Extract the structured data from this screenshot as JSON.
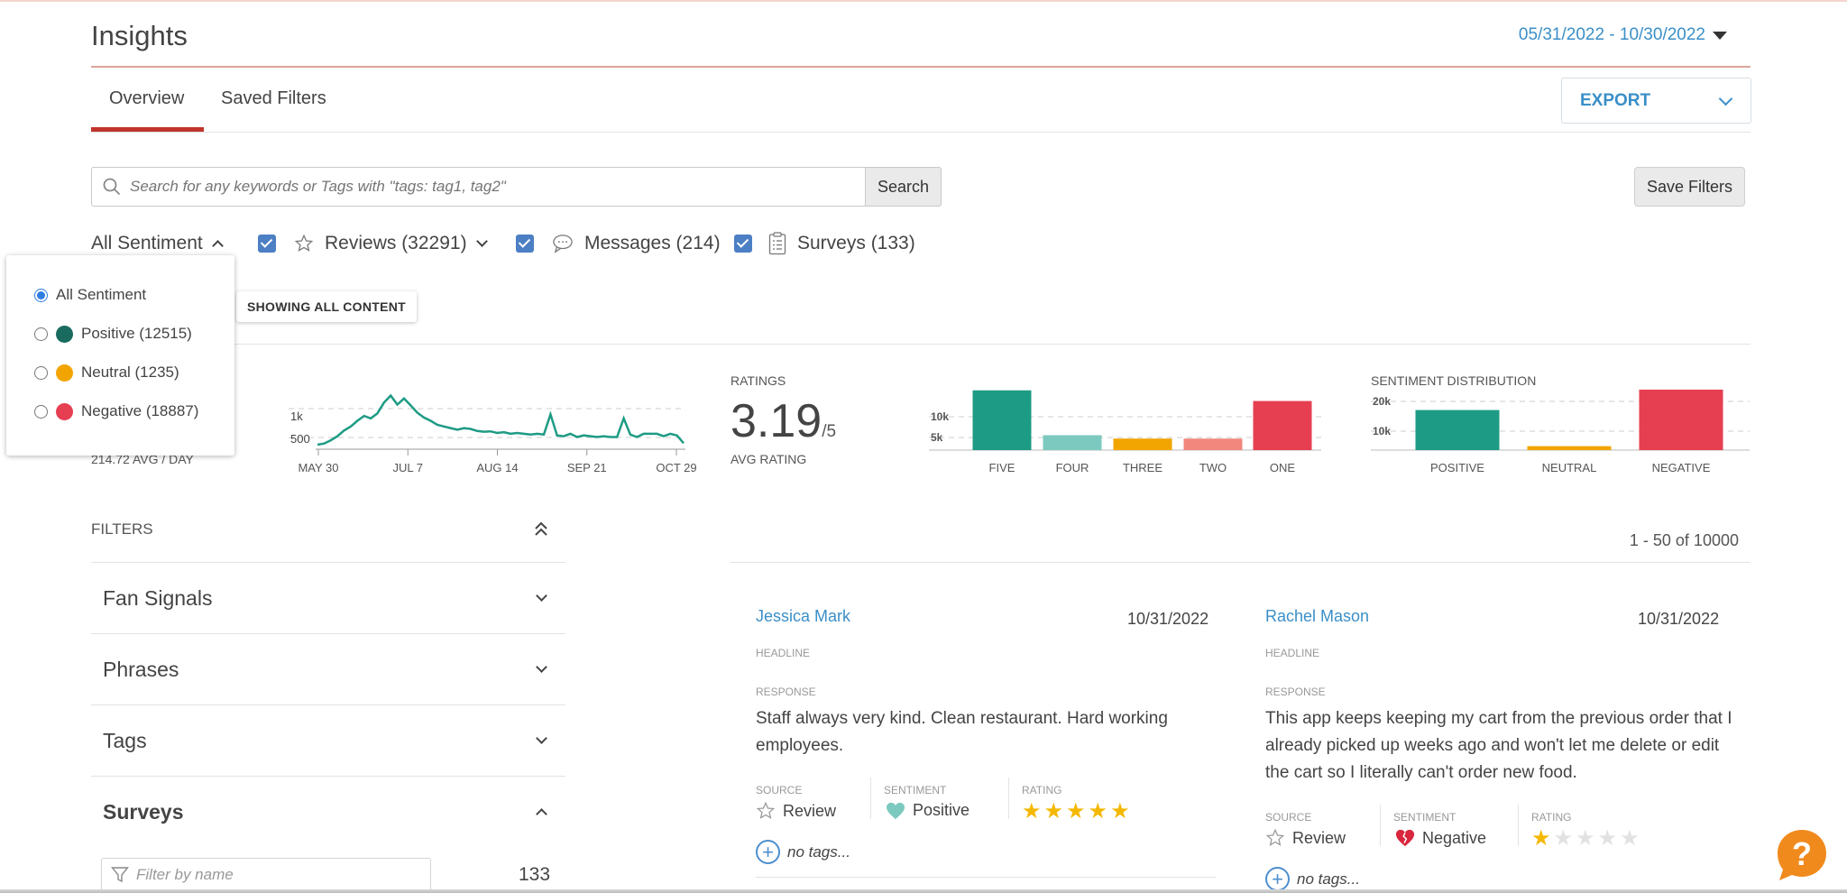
{
  "header": {
    "title": "Insights",
    "date_range": "05/31/2022 - 10/30/2022",
    "tabs": [
      {
        "label": "Overview",
        "active": true
      },
      {
        "label": "Saved Filters",
        "active": false
      }
    ],
    "export_label": "EXPORT"
  },
  "search": {
    "placeholder": "Search for any keywords or Tags with \"tags: tag1, tag2\"",
    "button_label": "Search",
    "save_filters_label": "Save Filters"
  },
  "filter_bar": {
    "sentiment_label": "All Sentiment",
    "reviews_label": "Reviews (32291)",
    "messages_label": "Messages (214)",
    "surveys_label": "Surveys (133)"
  },
  "sentiment_dropdown": {
    "options": [
      {
        "label": "All Sentiment",
        "selected": true
      },
      {
        "label": "Positive (12515)",
        "color": "#1a6b5f"
      },
      {
        "label": "Neutral (1235)",
        "color": "#f2a500"
      },
      {
        "label": "Negative (18887)",
        "color": "#e63f52"
      }
    ]
  },
  "showing_badge": "SHOWING ALL CONTENT",
  "volume": {
    "avg_label": "214.72 AVG / DAY",
    "y_ticks": [
      "1k",
      "500"
    ],
    "x_ticks": [
      "MAY 30",
      "JUL 7",
      "AUG 14",
      "SEP 21",
      "OCT 29"
    ],
    "line_color": "#1e9b84"
  },
  "ratings": {
    "label": "RATINGS",
    "value": "3.19",
    "suffix": "/5",
    "avg_label": "AVG RATING"
  },
  "chart_data": [
    {
      "type": "line",
      "x": [
        "MAY 30",
        "JUL 7",
        "AUG 14",
        "SEP 21",
        "OCT 29"
      ],
      "y_approx": [
        110,
        140,
        220,
        320,
        460,
        560,
        700,
        820,
        760,
        880,
        1150,
        1320,
        1100,
        1250,
        1080,
        900,
        780,
        700,
        600,
        560,
        520,
        480,
        520,
        500,
        450,
        430,
        440,
        400,
        420,
        380,
        400,
        380,
        360,
        380,
        360,
        860,
        340,
        320,
        380,
        300,
        340,
        320,
        300,
        320,
        300,
        300,
        760,
        360,
        300,
        380,
        380,
        380,
        320,
        380,
        340,
        150
      ],
      "ylim": [
        0,
        1400
      ],
      "yticks": [
        "1k",
        "500"
      ]
    },
    {
      "type": "bar",
      "categories": [
        "FIVE",
        "FOUR",
        "THREE",
        "TWO",
        "ONE"
      ],
      "values": [
        14000,
        3500,
        2700,
        2700,
        11500
      ],
      "colors": [
        "#1e9b84",
        "#7ccabf",
        "#f2a500",
        "#f2877d",
        "#e63f52"
      ],
      "ylim": [
        0,
        15000
      ],
      "yticks": [
        "10k",
        "5k"
      ]
    },
    {
      "type": "bar",
      "title": "SENTIMENT DISTRIBUTION",
      "categories": [
        "POSITIVE",
        "NEUTRAL",
        "NEGATIVE"
      ],
      "values": [
        12515,
        1235,
        18887
      ],
      "colors": [
        "#1e9b84",
        "#f2a500",
        "#e63f52"
      ],
      "ylim": [
        0,
        20000
      ],
      "yticks": [
        "20k",
        "10k"
      ]
    }
  ],
  "filters": {
    "title": "FILTERS",
    "items": [
      "Fan Signals",
      "Phrases",
      "Tags",
      "Surveys"
    ],
    "filter_placeholder": "Filter by name",
    "surveys_count": "133"
  },
  "results": {
    "count_label": "1 - 50 of 10000",
    "labels": {
      "headline": "HEADLINE",
      "response": "RESPONSE",
      "source": "SOURCE",
      "sentiment": "SENTIMENT",
      "rating": "RATING"
    },
    "no_tags": "no tags...",
    "cards": [
      {
        "name": "Jessica Mark",
        "date": "10/31/2022",
        "response": "Staff always very kind. Clean restaurant. Hard working employees.",
        "source": "Review",
        "sentiment": "Positive",
        "rating": 5
      },
      {
        "name": "Rachel Mason",
        "date": "10/31/2022",
        "response": "This app keeps keeping my cart from the previous order that I already picked up weeks ago and won't let me delete or edit the cart so I literally can't order new food.",
        "source": "Review",
        "sentiment": "Negative",
        "rating": 1
      }
    ]
  }
}
